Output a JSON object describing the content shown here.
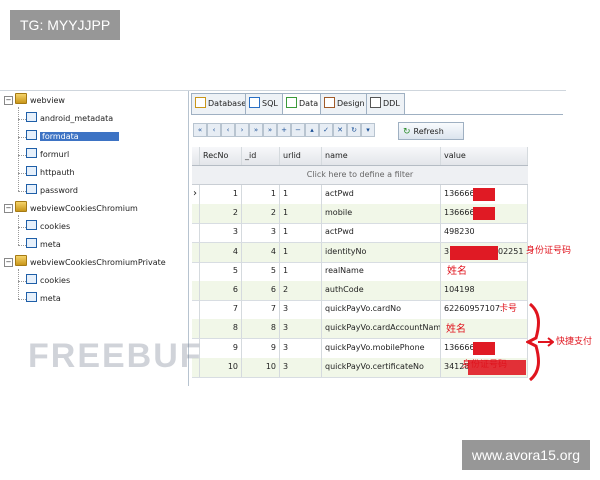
{
  "overlay": {
    "tg_badge": "TG: MYYJJPP",
    "site_badge": "www.avora15.org",
    "watermark": "FREEBUF"
  },
  "tree": {
    "databases": [
      {
        "name": "webview",
        "tables": [
          "android_metadata",
          "formdata",
          "formurl",
          "httpauth",
          "password"
        ]
      },
      {
        "name": "webviewCookiesChromium",
        "tables": [
          "cookies",
          "meta"
        ]
      },
      {
        "name": "webviewCookiesChromiumPrivate",
        "tables": [
          "cookies",
          "meta"
        ]
      }
    ],
    "selected": "formdata"
  },
  "tabs": [
    {
      "label": "Database",
      "icon": "database-icon"
    },
    {
      "label": "SQL",
      "icon": "sql-icon"
    },
    {
      "label": "Data",
      "icon": "data-icon",
      "active": true
    },
    {
      "label": "Design",
      "icon": "design-icon"
    },
    {
      "label": "DDL",
      "icon": "ddl-icon"
    }
  ],
  "toolbar": {
    "nav_buttons": [
      "«",
      "‹",
      "‹",
      "›",
      "»",
      "»",
      "+",
      "−",
      "▴",
      "✓",
      "✕",
      "↻",
      "▾"
    ],
    "refresh_label": "Refresh"
  },
  "grid": {
    "columns": [
      "RecNo",
      "_id",
      "urlid",
      "name",
      "value"
    ],
    "filter_hint": "Click here to define a filter",
    "rows": [
      [
        "1",
        "1",
        "1",
        "actPwd",
        "136666"
      ],
      [
        "2",
        "2",
        "1",
        "mobile",
        "136666"
      ],
      [
        "3",
        "3",
        "1",
        "actPwd",
        "498230"
      ],
      [
        "4",
        "4",
        "1",
        "identityNo",
        "3"
      ],
      [
        "5",
        "5",
        "1",
        "realName",
        ""
      ],
      [
        "6",
        "6",
        "2",
        "authCode",
        "104198"
      ],
      [
        "7",
        "7",
        "3",
        "quickPayVo.cardNo",
        "62260957107."
      ],
      [
        "8",
        "8",
        "3",
        "quickPayVo.cardAccountName",
        ""
      ],
      [
        "9",
        "9",
        "3",
        "quickPayVo.mobilePhone",
        "136666"
      ],
      [
        "10",
        "10",
        "3",
        "quickPayVo.certificateNo",
        "34128"
      ]
    ],
    "row4_suffix": "02251"
  },
  "annotations": {
    "id_label": "身份证号码",
    "name_label_1": "姓名",
    "card_label": "卡号",
    "name_label_2": "姓名",
    "quickpay_label": "快捷支付",
    "cert_label": "身份证号码"
  },
  "colors": {
    "annotation_red": "#e0141e",
    "selection_blue": "#3d73c4",
    "alt_row": "#f1f7e8"
  }
}
